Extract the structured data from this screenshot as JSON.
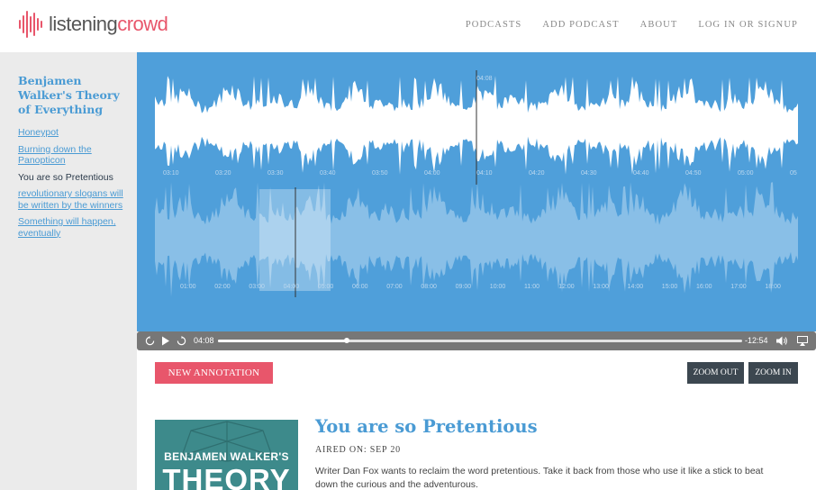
{
  "brand": {
    "name_part1": "listening",
    "name_part2": "crowd",
    "accent_color": "#e8566b"
  },
  "nav": {
    "items": [
      "PODCASTS",
      "ADD PODCAST",
      "ABOUT",
      "LOG IN OR SIGNUP"
    ]
  },
  "sidebar": {
    "podcast_title": "Benjamen Walker's Theory of Everything",
    "episodes": [
      {
        "label": "Honeypot",
        "active": false
      },
      {
        "label": "Burning down the Panopticon",
        "active": false
      },
      {
        "label": "You are so Pretentious",
        "active": true
      },
      {
        "label": "revolutionary slogans will be written by the winners",
        "active": false
      },
      {
        "label": "Something will happen, eventually",
        "active": false
      }
    ]
  },
  "waveform": {
    "background_color": "#4f9fda",
    "zoom_ticks": [
      "03:10",
      "03:20",
      "03:30",
      "03:40",
      "03:50",
      "04:00",
      "04:10",
      "04:20",
      "04:30",
      "04:40",
      "04:50",
      "05:00",
      "05"
    ],
    "playhead_label": "04:08",
    "overview_ticks": [
      "01:00",
      "02:00",
      "03:00",
      "04:00",
      "05:00",
      "06:00",
      "07:00",
      "08:00",
      "09:00",
      "10:00",
      "11:00",
      "12:00",
      "13:00",
      "14:00",
      "15:00",
      "16:00",
      "17:00",
      "18:00"
    ]
  },
  "player": {
    "elapsed": "04:08",
    "remaining": "-12:54",
    "progress_fraction": 0.245
  },
  "toolbar": {
    "new_annotation": "NEW ANNOTATION",
    "zoom_out": "ZOOM OUT",
    "zoom_in": "ZOOM IN"
  },
  "episode": {
    "title": "You are so Pretentious",
    "aired": "AIRED ON: SEP 20",
    "description": "Writer Dan Fox wants to reclaim the word pretentious. Take it back from those who use it like a stick to beat down the curious and the adventurous.",
    "cover": {
      "line1": "BENJAMEN WALKER'S",
      "line2": "THEORY"
    }
  }
}
